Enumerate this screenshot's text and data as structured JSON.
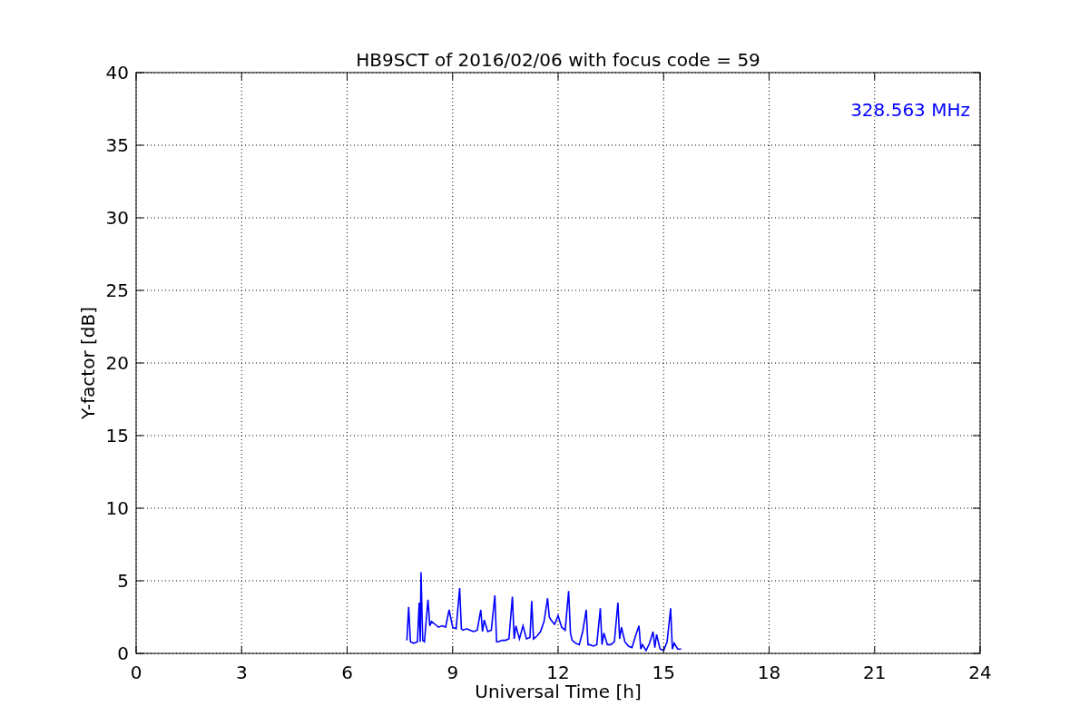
{
  "chart_data": {
    "type": "line",
    "title": "HB9SCT of 2016/02/06 with focus code = 59",
    "xlabel": "Universal Time [h]",
    "ylabel": "Y-factor [dB]",
    "x": [
      7.7,
      7.75,
      7.8,
      7.9,
      8.0,
      8.05,
      8.08,
      8.1,
      8.15,
      8.2,
      8.3,
      8.35,
      8.4,
      8.5,
      8.6,
      8.7,
      8.8,
      8.9,
      9.0,
      9.1,
      9.2,
      9.25,
      9.3,
      9.4,
      9.5,
      9.6,
      9.7,
      9.8,
      9.85,
      9.9,
      10.0,
      10.1,
      10.2,
      10.25,
      10.3,
      10.4,
      10.5,
      10.6,
      10.7,
      10.75,
      10.8,
      10.9,
      11.0,
      11.1,
      11.2,
      11.25,
      11.3,
      11.4,
      11.5,
      11.6,
      11.7,
      11.75,
      11.8,
      11.9,
      12.0,
      12.1,
      12.2,
      12.3,
      12.35,
      12.4,
      12.5,
      12.6,
      12.7,
      12.8,
      12.85,
      12.9,
      13.0,
      13.1,
      13.2,
      13.25,
      13.3,
      13.4,
      13.5,
      13.6,
      13.7,
      13.75,
      13.8,
      13.9,
      14.0,
      14.1,
      14.2,
      14.3,
      14.35,
      14.4,
      14.5,
      14.6,
      14.7,
      14.75,
      14.8,
      14.9,
      15.0,
      15.1,
      15.2,
      15.25,
      15.3,
      15.4,
      15.5
    ],
    "series": [
      {
        "name": "328.563 MHz",
        "color": "#0000ff",
        "values": [
          0.9,
          3.2,
          0.8,
          0.7,
          0.8,
          3.5,
          0.8,
          5.6,
          0.9,
          0.8,
          3.7,
          1.9,
          2.2,
          2.0,
          1.8,
          1.9,
          1.8,
          3.0,
          1.8,
          1.7,
          4.5,
          1.7,
          1.6,
          1.7,
          1.6,
          1.5,
          1.6,
          3.0,
          1.5,
          2.3,
          1.5,
          1.6,
          4.0,
          0.8,
          0.8,
          0.9,
          0.9,
          1.0,
          3.9,
          1.0,
          1.9,
          1.0,
          1.9,
          1.0,
          1.1,
          3.6,
          1.0,
          1.2,
          1.5,
          2.2,
          3.8,
          2.5,
          2.3,
          2.0,
          2.6,
          1.8,
          1.6,
          4.3,
          1.4,
          0.9,
          0.7,
          0.6,
          1.5,
          3.0,
          0.6,
          0.6,
          0.5,
          0.6,
          3.1,
          0.6,
          1.4,
          0.6,
          0.6,
          0.8,
          3.5,
          1.0,
          1.8,
          0.8,
          0.5,
          0.4,
          1.2,
          1.9,
          0.3,
          0.6,
          0.2,
          0.7,
          1.5,
          0.4,
          1.3,
          0.3,
          0.2,
          0.8,
          3.1,
          0.3,
          0.7,
          0.3,
          0.3
        ]
      }
    ],
    "xlim": [
      0,
      24
    ],
    "ylim": [
      0,
      40
    ],
    "xticks": [
      0,
      3,
      6,
      9,
      12,
      15,
      18,
      21,
      24
    ],
    "yticks": [
      0,
      5,
      10,
      15,
      20,
      25,
      30,
      35,
      40
    ],
    "grid": true
  }
}
